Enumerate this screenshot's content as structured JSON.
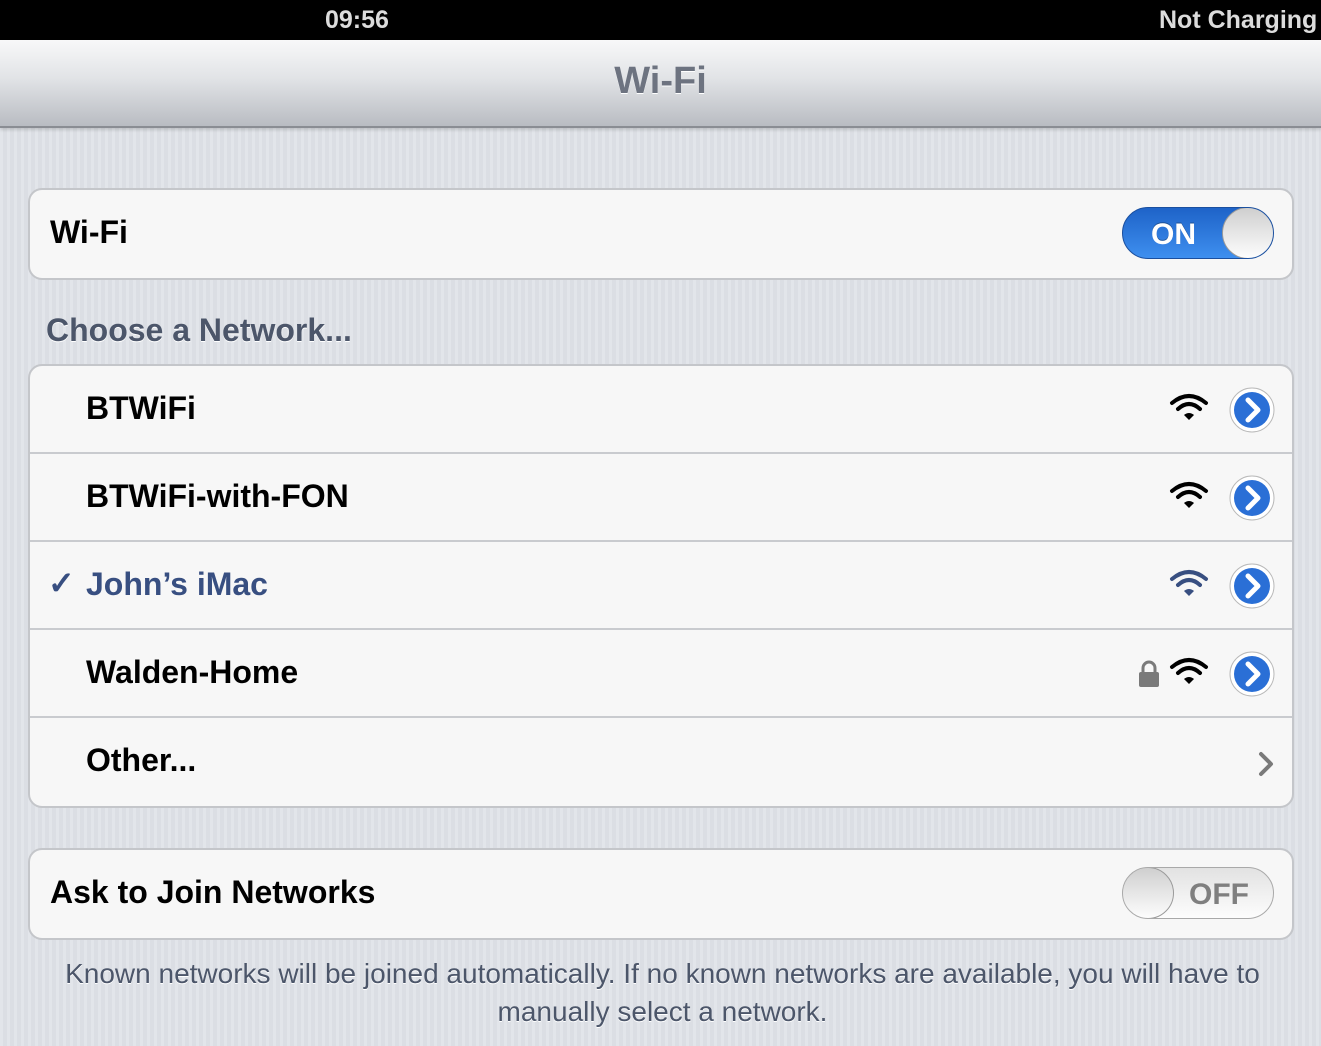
{
  "status_bar": {
    "time": "09:56",
    "battery_text": "Not Charging"
  },
  "nav": {
    "title": "Wi-Fi"
  },
  "wifi": {
    "label": "Wi-Fi",
    "toggle_text": "ON",
    "enabled": true
  },
  "networks": {
    "header": "Choose a Network...",
    "items": [
      {
        "name": "BTWiFi",
        "secured": false,
        "selected": false
      },
      {
        "name": "BTWiFi-with-FON",
        "secured": false,
        "selected": false
      },
      {
        "name": "John’s iMac",
        "secured": false,
        "selected": true,
        "check": "✓"
      },
      {
        "name": "Walden-Home",
        "secured": true,
        "selected": false
      }
    ],
    "other": "Other..."
  },
  "ask_to_join": {
    "label": "Ask to Join Networks",
    "toggle_text": "OFF",
    "enabled": false
  },
  "footer_note": "Known networks will be joined automatically. If no known networks are available, you will have to manually select a network.",
  "colors": {
    "accent": "#2a6fd6",
    "selected_text": "#384f81",
    "group_header": "#4c566a"
  },
  "icons": [
    "wifi-signal-icon",
    "lock-icon",
    "detail-disclosure-icon",
    "chevron-right-icon"
  ]
}
